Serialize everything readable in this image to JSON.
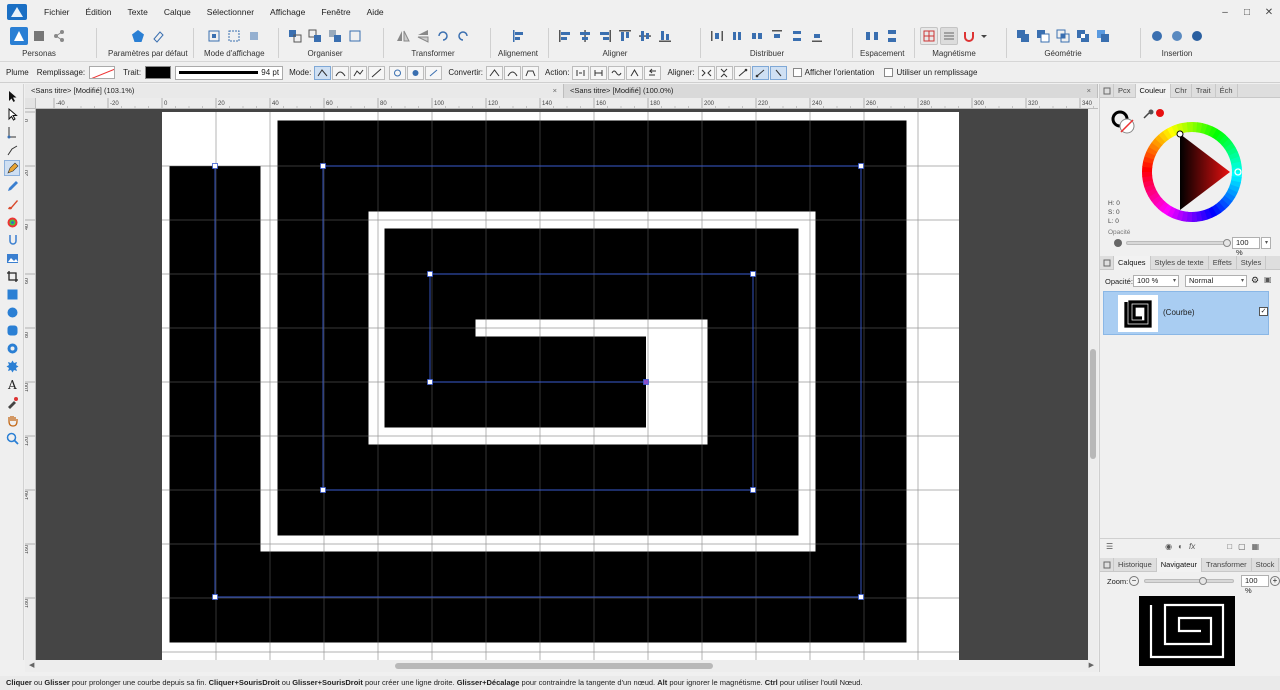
{
  "app": {
    "name": "Affinity Designer"
  },
  "menu": [
    "Fichier",
    "Édition",
    "Texte",
    "Calque",
    "Sélectionner",
    "Affichage",
    "Fenêtre",
    "Aide"
  ],
  "toolbar": {
    "personas": "Personas",
    "params": "Paramètres par défaut",
    "view_mode": "Mode d'affichage",
    "arrange": "Organiser",
    "transform": "Transformer",
    "alignment": "Alignement",
    "align": "Aligner",
    "distribute": "Distribuer",
    "spacing": "Espacement",
    "snapping": "Magnétisme",
    "geometry": "Géométrie",
    "insert": "Insertion"
  },
  "context": {
    "tool": "Plume",
    "fill": "Remplissage:",
    "stroke": "Trait:",
    "width": "94 pt",
    "mode": "Mode:",
    "convert": "Convertir:",
    "action": "Action:",
    "align": "Aligner:",
    "show_orientation": "Afficher l'orientation",
    "use_fill": "Utiliser un remplissage"
  },
  "doc_tabs": [
    {
      "title": "<Sans titre> [Modifié] (103.1%)",
      "active": true
    },
    {
      "title": "<Sans titre> [Modifié] (100.0%)",
      "active": false
    }
  ],
  "ruler_h": [
    "-40",
    "-20",
    "0",
    "20",
    "40",
    "60",
    "80",
    "100",
    "120",
    "140",
    "160",
    "180",
    "200",
    "220",
    "240",
    "260",
    "280",
    "300",
    "320",
    "340"
  ],
  "ruler_v": [
    "0",
    "20",
    "40",
    "60",
    "80",
    "100",
    "120",
    "140",
    "160",
    "180"
  ],
  "color_panel": {
    "tabs": [
      "Pcx",
      "Couleur",
      "Chr",
      "Trait",
      "Éch"
    ],
    "active": "Couleur",
    "h": "H: 0",
    "s": "S: 0",
    "l": "L: 0",
    "opacity_label": "Opacité",
    "opacity_value": "100 %",
    "opacity": 1.0
  },
  "layers_panel": {
    "tabs": [
      "Calques",
      "Styles de texte",
      "Effets",
      "Styles"
    ],
    "active": "Calques",
    "opacity_label": "Opacité:",
    "opacity_value": "100 %",
    "blend_mode": "Normal",
    "layers": [
      {
        "name": "(Courbe)",
        "visible": true
      }
    ]
  },
  "navigator_panel": {
    "tabs": [
      "Historique",
      "Navigateur",
      "Transformer",
      "Stock"
    ],
    "active": "Navigateur",
    "zoom_label": "Zoom:",
    "zoom_value": "100 %",
    "zoom_level": 0.65
  },
  "status": {
    "b1": "Cliquer",
    "t1": " ou ",
    "b2": "Glisser",
    "t2": " pour prolonger une courbe depuis sa fin. ",
    "b3": "Cliquer+SourisDroit",
    "t3": " ou ",
    "b4": "Glisser+SourisDroit",
    "t4": " pour créer une ligne droite. ",
    "b5": "Glisser+Décalage",
    "t5": " pour contraindre la tangente d'un nœud. ",
    "b6": "Alt",
    "t6": " pour ignorer le magnétisme. ",
    "b7": "Ctrl",
    "t7": " pour utiliser l'outil Nœud."
  },
  "colors": {
    "accent": "#2a7fd4",
    "stroke": "#000000",
    "selection": "#3a5bd0",
    "pasteboard": "#454545"
  }
}
